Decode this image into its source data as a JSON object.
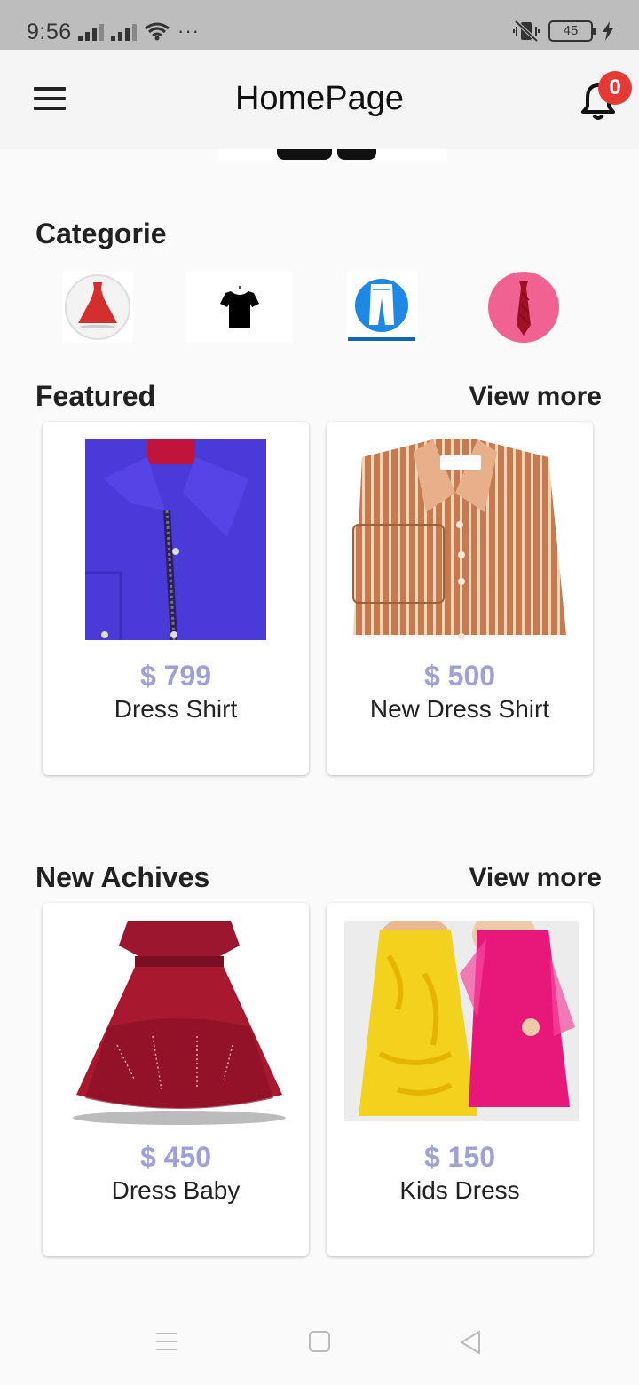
{
  "status_bar": {
    "time": "9:56",
    "more": "···",
    "battery": "45"
  },
  "app_bar": {
    "title": "HomePage",
    "notification_count": "0"
  },
  "categories": {
    "title": "Categorie",
    "items": [
      {
        "icon": "dress-icon"
      },
      {
        "icon": "tshirt-icon"
      },
      {
        "icon": "pants-icon"
      },
      {
        "icon": "tie-icon"
      }
    ]
  },
  "featured": {
    "title": "Featured",
    "view_more": "View more",
    "products": [
      {
        "price": "$ 799",
        "name": "Dress Shirt"
      },
      {
        "price": "$ 500",
        "name": "New Dress Shirt"
      }
    ]
  },
  "new_archives": {
    "title": "New Achives",
    "view_more": "View more",
    "products": [
      {
        "price": "$ 450",
        "name": "Dress Baby"
      },
      {
        "price": "$ 150",
        "name": "Kids Dress"
      }
    ]
  },
  "colors": {
    "price": "#9fa0d8",
    "badge": "#e53935",
    "app_bar": "#f5f5f5",
    "status_bar": "#bdbdbd"
  }
}
